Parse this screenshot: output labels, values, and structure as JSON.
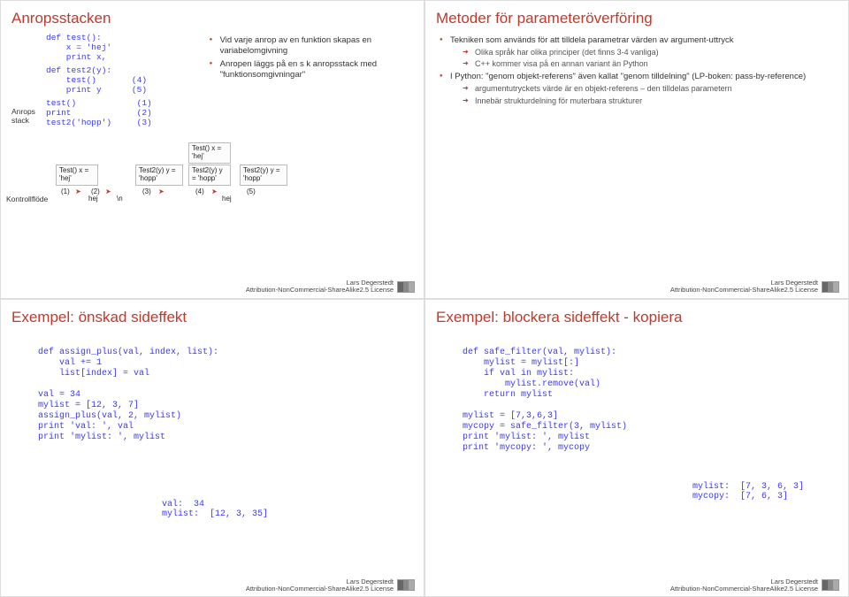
{
  "footer": {
    "author": "Lars Degerstedt",
    "license": "Attribution-NonCommercial-ShareAlike2.5 License"
  },
  "slide1": {
    "title": "Anropsstacken",
    "stack_label": "Anrops\nstack",
    "flow_label": "Kontrollflöde",
    "code1": "def test():\n    x = 'hej'\n    print x,",
    "code2": "def test2(y):\n    test()       (4)\n    print y      (5)",
    "code3": "test()            (1)\nprint             (2)\ntest2('hopp')     (3)",
    "bul1": "Vid varje anrop av en funktion skapas en variabelomgivning",
    "bul2": "Anropen läggs på en s k anropsstack med \"funktionsomgivningar\"",
    "box_test": "Test()\nx = 'hej'",
    "box_test2": "Test2(y)\ny = 'hopp'",
    "d_nums": [
      "(1)",
      "(2)",
      "(3)",
      "(4)",
      "(5)"
    ],
    "d_hej": "hej",
    "d_bn": "\\n"
  },
  "slide2": {
    "title": "Metoder för parameteröverföring",
    "b1": "Tekniken som används för att tilldela parametrar värden av argument-uttryck",
    "b1a": "Olika språk har olika principer (det finns 3-4 vanliga)",
    "b1b": "C++ kommer visa på en annan variant än Python",
    "b2": "I Python: \"genom objekt-referens\" även kallat \"genom tilldelning\" (LP-boken: pass-by-reference)",
    "b2a": "argumentutryckets värde är en objekt-referens – den tilldelas parametern",
    "b2b": "Innebär strukturdelning för muterbara strukturer"
  },
  "slide3": {
    "title": "Exempel: önskad sideffekt",
    "code": "def assign_plus(val, index, list):\n    val += 1\n    list[index] = val\n\nval = 34\nmylist = [12, 3, 7]\nassign_plus(val, 2, mylist)\nprint 'val: ', val\nprint 'mylist: ', mylist",
    "out": "val:  34\nmylist:  [12, 3, 35]"
  },
  "slide4": {
    "title": "Exempel: blockera sideffekt - kopiera",
    "code": "def safe_filter(val, mylist):\n    mylist = mylist[:]\n    if val in mylist:\n        mylist.remove(val)\n    return mylist\n\nmylist = [7,3,6,3]\nmycopy = safe_filter(3, mylist)\nprint 'mylist: ', mylist\nprint 'mycopy: ', mycopy",
    "out": "mylist:  [7, 3, 6, 3]\nmycopy:  [7, 6, 3]"
  }
}
